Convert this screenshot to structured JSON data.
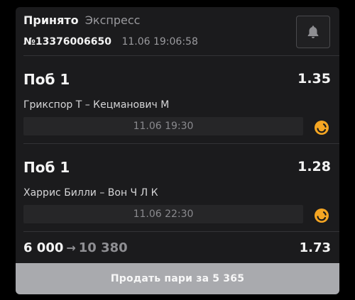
{
  "header": {
    "status": "Принято",
    "bet_type": "Экспресс",
    "bet_id": "№13376006650",
    "datetime": "11.06 19:06:58",
    "bell_icon": "bell-icon"
  },
  "events": [
    {
      "market": "Поб 1",
      "odds": "1.35",
      "teams": "Грикспор Т – Кецманович М",
      "start_time": "11.06 19:30",
      "icon": "live-tennis-icon"
    },
    {
      "market": "Поб 1",
      "odds": "1.28",
      "teams": "Харрис Билли – Вон Ч Л К",
      "start_time": "11.06 22:30",
      "icon": "live-tennis-icon"
    }
  ],
  "totals": {
    "stake": "6 000",
    "arrow": "→",
    "payout": "10 380",
    "total_odds": "1.73"
  },
  "sell_button": {
    "label": "Продать пари за 5 365"
  },
  "colors": {
    "card_background": "#1b1b1d",
    "accent_orange": "#f5a623",
    "sell_button_background": "#a9aaae"
  }
}
